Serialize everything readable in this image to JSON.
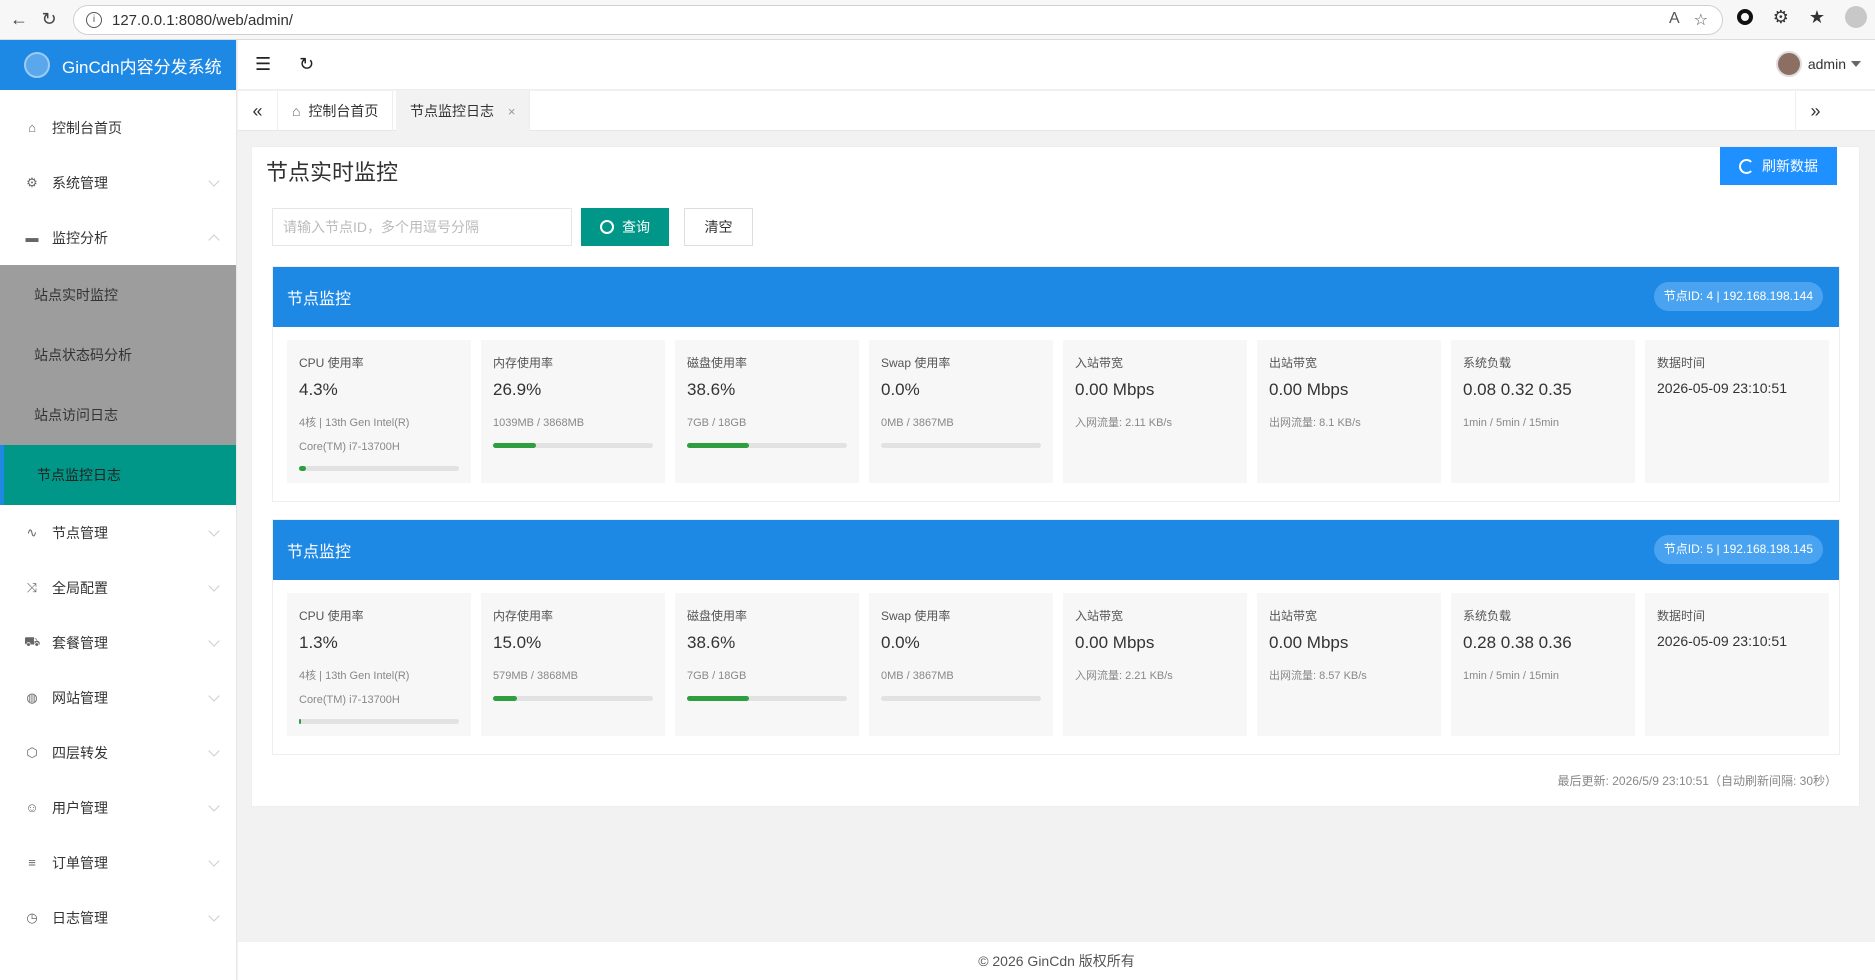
{
  "browser": {
    "url": "127.0.0.1:8080/web/admin/"
  },
  "app": {
    "title": "GinCdn内容分发系统",
    "username": "admin"
  },
  "sidebar": {
    "items": [
      {
        "label": "控制台首页",
        "icon": "home-icon"
      },
      {
        "label": "系统管理",
        "icon": "gear-icon"
      },
      {
        "label": "监控分析",
        "icon": "monitor-icon"
      },
      {
        "label": "节点管理",
        "icon": "pulse-icon"
      },
      {
        "label": "全局配置",
        "icon": "shuffle-icon"
      },
      {
        "label": "套餐管理",
        "icon": "cart-icon"
      },
      {
        "label": "网站管理",
        "icon": "globe-icon"
      },
      {
        "label": "四层转发",
        "icon": "cube-icon"
      },
      {
        "label": "用户管理",
        "icon": "user-icon"
      },
      {
        "label": "订单管理",
        "icon": "list-icon"
      },
      {
        "label": "日志管理",
        "icon": "clock-icon"
      }
    ],
    "submenu": [
      {
        "label": "站点实时监控"
      },
      {
        "label": "站点状态码分析"
      },
      {
        "label": "站点访问日志"
      },
      {
        "label": "节点监控日志",
        "active": true
      }
    ]
  },
  "tabs": [
    {
      "label": "控制台首页"
    },
    {
      "label": "节点监控日志",
      "close": "×"
    }
  ],
  "page": {
    "title": "节点实时监控",
    "refresh_label": "刷新数据",
    "search_placeholder": "请输入节点ID，多个用逗号分隔",
    "query_label": "查询",
    "clear_label": "清空",
    "last_update": "最后更新: 2026/5/9 23:10:51（自动刷新间隔: 30秒）"
  },
  "nodes": [
    {
      "title": "节点监控",
      "badge": "节点ID: 4 | 192.168.198.144",
      "cpu": {
        "label": "CPU 使用率",
        "value": "4.3%",
        "sub": "4核 | 13th Gen Intel(R) Core(TM) i7-13700H",
        "pct": 4.3
      },
      "mem": {
        "label": "内存使用率",
        "value": "26.9%",
        "sub": "1039MB / 3868MB",
        "pct": 26.9
      },
      "disk": {
        "label": "磁盘使用率",
        "value": "38.6%",
        "sub": "7GB / 18GB",
        "pct": 38.6
      },
      "swap": {
        "label": "Swap 使用率",
        "value": "0.0%",
        "sub": "0MB / 3867MB",
        "pct": 0
      },
      "in": {
        "label": "入站带宽",
        "value": "0.00 Mbps",
        "sub": "入网流量: 2.11 KB/s"
      },
      "out": {
        "label": "出站带宽",
        "value": "0.00 Mbps",
        "sub": "出网流量: 8.1 KB/s"
      },
      "load": {
        "label": "系统负载",
        "value": "0.08 0.32 0.35",
        "sub": "1min / 5min / 15min"
      },
      "time": {
        "label": "数据时间",
        "value": "2026-05-09 23:10:51"
      }
    },
    {
      "title": "节点监控",
      "badge": "节点ID: 5 | 192.168.198.145",
      "cpu": {
        "label": "CPU 使用率",
        "value": "1.3%",
        "sub": "4核 | 13th Gen Intel(R) Core(TM) i7-13700H",
        "pct": 1.3
      },
      "mem": {
        "label": "内存使用率",
        "value": "15.0%",
        "sub": "579MB / 3868MB",
        "pct": 15.0
      },
      "disk": {
        "label": "磁盘使用率",
        "value": "38.6%",
        "sub": "7GB / 18GB",
        "pct": 38.6
      },
      "swap": {
        "label": "Swap 使用率",
        "value": "0.0%",
        "sub": "0MB / 3867MB",
        "pct": 0
      },
      "in": {
        "label": "入站带宽",
        "value": "0.00 Mbps",
        "sub": "入网流量: 2.21 KB/s"
      },
      "out": {
        "label": "出站带宽",
        "value": "0.00 Mbps",
        "sub": "出网流量: 8.57 KB/s"
      },
      "load": {
        "label": "系统负载",
        "value": "0.28 0.38 0.36",
        "sub": "1min / 5min / 15min"
      },
      "time": {
        "label": "数据时间",
        "value": "2026-05-09 23:10:51"
      }
    }
  ],
  "footer": {
    "text": "© 2026 GinCdn 版权所有"
  },
  "colors": {
    "brand": "#1e88e5",
    "accent": "#009688",
    "progress": "#2e9e3e"
  }
}
